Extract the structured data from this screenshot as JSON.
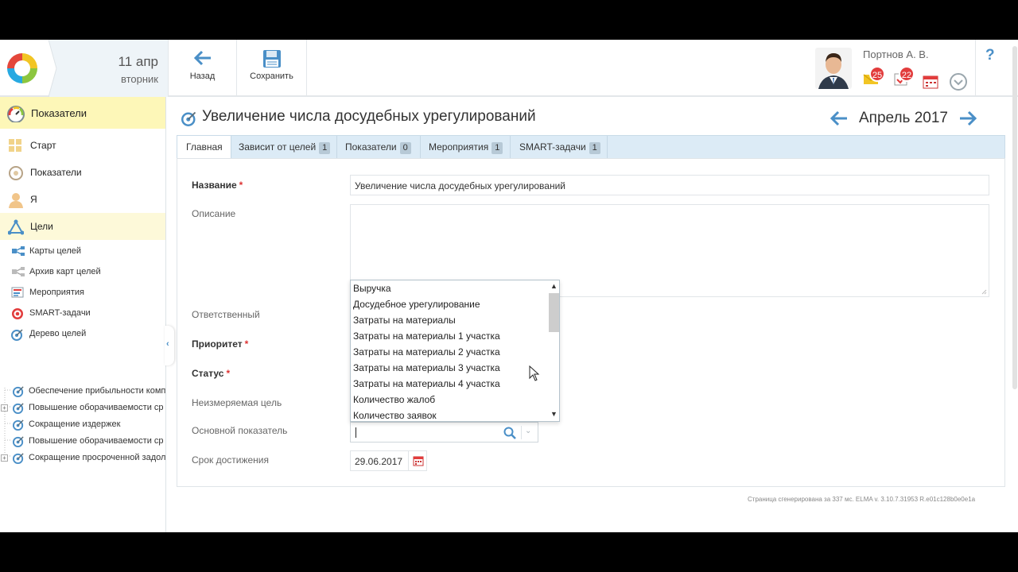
{
  "header": {
    "date_day": "11 апр",
    "date_weekday": "вторник",
    "back_label": "Назад",
    "save_label": "Сохранить",
    "user_name": "Портнов А. В.",
    "messages_count": "25",
    "tasks_count": "22",
    "help_label": "?"
  },
  "sidebar": {
    "header_label": "Показатели",
    "items": [
      {
        "label": "Старт",
        "icon": "grid-icon"
      },
      {
        "label": "Показатели",
        "icon": "gauge-icon"
      },
      {
        "label": "Я",
        "icon": "person-icon"
      },
      {
        "label": "Цели",
        "icon": "goals-triangle-icon"
      }
    ],
    "sub_items": [
      {
        "label": "Карты целей",
        "icon": "goal-map-icon"
      },
      {
        "label": "Архив карт целей",
        "icon": "archive-map-icon"
      },
      {
        "label": "Мероприятия",
        "icon": "events-icon"
      },
      {
        "label": "SMART-задачи",
        "icon": "target-icon"
      },
      {
        "label": "Дерево целей",
        "icon": "target-arrow-icon"
      }
    ],
    "tree": [
      {
        "label": "Обеспечение прибыльности комп"
      },
      {
        "label": "Повышение оборачиваемости ср"
      },
      {
        "label": "Сокращение издержек"
      },
      {
        "label": "Повышение оборачиваемости ср"
      },
      {
        "label": "Сокращение просроченной задол"
      }
    ]
  },
  "page": {
    "title": "Увеличение числа досудебных урегулирований",
    "period": "Апрель 2017"
  },
  "tabs": [
    {
      "label": "Главная"
    },
    {
      "label": "Зависит от целей",
      "count": "1"
    },
    {
      "label": "Показатели",
      "count": "0"
    },
    {
      "label": "Мероприятия",
      "count": "1"
    },
    {
      "label": "SMART-задачи",
      "count": "1"
    }
  ],
  "form": {
    "name_label": "Название",
    "name_value": "Увеличение числа досудебных урегулирований",
    "description_label": "Описание",
    "responsible_label": "Ответственный",
    "priority_label": "Приоритет",
    "status_label": "Статус",
    "unmeasurable_label": "Неизмеряемая цель",
    "main_metric_label": "Основной показатель",
    "deadline_label": "Срок достижения",
    "deadline_value": "29.06.2017",
    "required_mark": "*"
  },
  "dropdown": {
    "options": [
      "Выручка",
      "Досудебное урегулирование",
      "Затраты на материалы",
      "Затраты на материалы 1 участка",
      "Затраты на материалы 2 участка",
      "Затраты на материалы 3 участка",
      "Затраты на материалы 4 участка",
      "Количество жалоб",
      "Количество заявок"
    ]
  },
  "footer": {
    "generated_text": "Страница сгенерирована за 337 мс. ELMA v. 3.10.7.31953 R.e01c128b0e0e1a"
  },
  "colors": {
    "accent_blue": "#4a8fc7",
    "sidebar_highlight": "#fdf7b8",
    "tab_bar": "#dcebf6",
    "badge_red": "#e23c3c"
  }
}
